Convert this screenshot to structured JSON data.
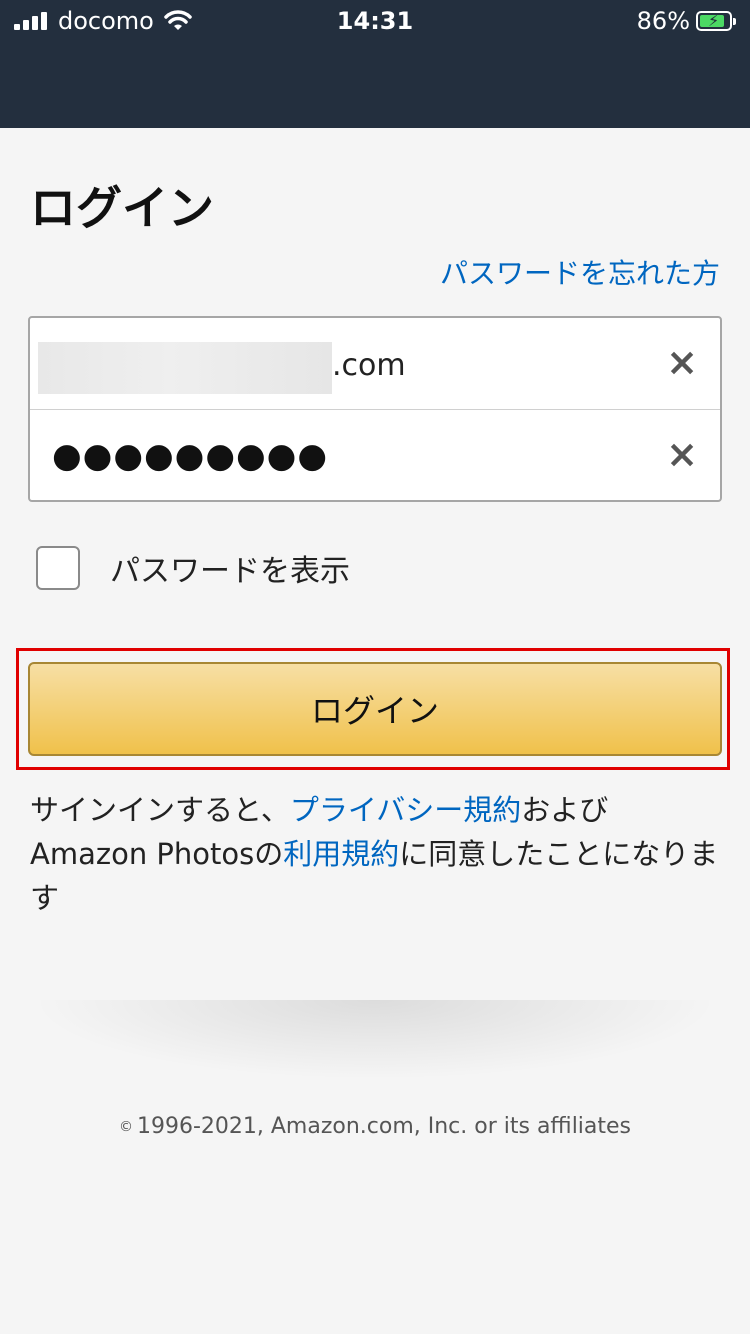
{
  "status_bar": {
    "carrier": "docomo",
    "time": "14:31",
    "battery_percent": "86%",
    "battery_level": 0.86,
    "icons": [
      "signal-icon",
      "wifi-icon",
      "battery-charging-icon"
    ]
  },
  "page": {
    "title": "ログイン",
    "forgot_password": "パスワードを忘れた方"
  },
  "form": {
    "email_visible_suffix": ".com",
    "password_mask": "●●●●●●●●●",
    "clear_icon": "×",
    "show_password_label": "パスワードを表示",
    "show_password_checked": false
  },
  "login_button": {
    "label": "ログイン"
  },
  "terms": {
    "prefix": "サインインすると、",
    "privacy_link": "プライバシー規約",
    "middle": "および Amazon Photosの",
    "terms_link": "利用規約",
    "suffix": "に同意したことになります"
  },
  "footer": {
    "copyright_symbol": "©",
    "text": "1996-2021, Amazon.com, Inc. or its affiliates"
  },
  "colors": {
    "header_bg": "#232f3e",
    "link": "#0066c0",
    "button_top": "#f7dfa5",
    "button_bottom": "#f0c14b",
    "highlight": "#e00000",
    "battery_green": "#4cd964"
  }
}
